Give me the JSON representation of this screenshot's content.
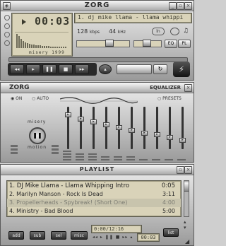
{
  "player": {
    "title": "ZORG",
    "time": "00:03",
    "track_title": "1. dj mike llama - llama whippi",
    "kbps": "128",
    "kbps_unit": "kbps",
    "khz": "44",
    "khz_unit": "kHz",
    "visualizer_label": "misery 1999",
    "mode_a": "ln",
    "mode_b": "ra",
    "controls": [
      "prev",
      "play",
      "pause",
      "stop",
      "next",
      "eject"
    ]
  },
  "equalizer": {
    "title": "ZORG",
    "title_right": "EQUALIZER",
    "on_label": "ON",
    "auto_label": "AUTO",
    "presets_label": "PRESETS",
    "side_label_top": "misery",
    "side_label_bottom": "motion",
    "bands_level": [
      0.55,
      0.5,
      0.45,
      0.4,
      0.35,
      0.3,
      0.25,
      0.25,
      0.2,
      0.15
    ]
  },
  "playlist": {
    "title": "PLAYLIST",
    "items": [
      {
        "label": "1. DJ Mike Llama - Llama Whipping Intro",
        "duration": "0:05"
      },
      {
        "label": "2. Marilyn Manson - Rock Is Dead",
        "duration": "3:11"
      },
      {
        "label": "3. Propellerheads - Spybreak! (Short One)",
        "duration": "4:00"
      },
      {
        "label": "4. Ministry - Bad Blood",
        "duration": "5:00"
      }
    ],
    "buttons": [
      "add",
      "sub",
      "sel",
      "misc"
    ],
    "list_button": "list",
    "time_total": "0:00/12:16",
    "time_current": "00:03"
  },
  "colors": {
    "lcd": "#d9d3b9",
    "chrome": "#bdbdbd",
    "selected_row": "#c8c4ad"
  }
}
